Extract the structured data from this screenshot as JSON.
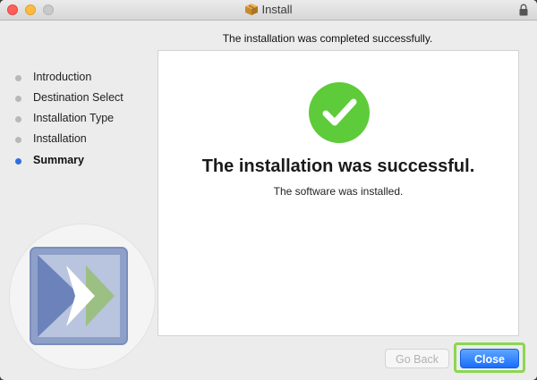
{
  "window": {
    "title": "Install"
  },
  "header": {
    "message": "The installation was completed successfully."
  },
  "sidebar": {
    "steps": [
      {
        "label": "Introduction",
        "state": "done"
      },
      {
        "label": "Destination Select",
        "state": "done"
      },
      {
        "label": "Installation Type",
        "state": "done"
      },
      {
        "label": "Installation",
        "state": "done"
      },
      {
        "label": "Summary",
        "state": "current"
      }
    ]
  },
  "main": {
    "status_icon": "checkmark-circle-icon",
    "title": "The installation was successful.",
    "subtitle": "The software was installed."
  },
  "buttons": {
    "back_label": "Go Back",
    "close_label": "Close"
  },
  "colors": {
    "success_green": "#5ecb3a",
    "accent_blue": "#1a6dfb",
    "current_step_dot": "#2d6fe0",
    "highlight_green": "#8cd650"
  }
}
